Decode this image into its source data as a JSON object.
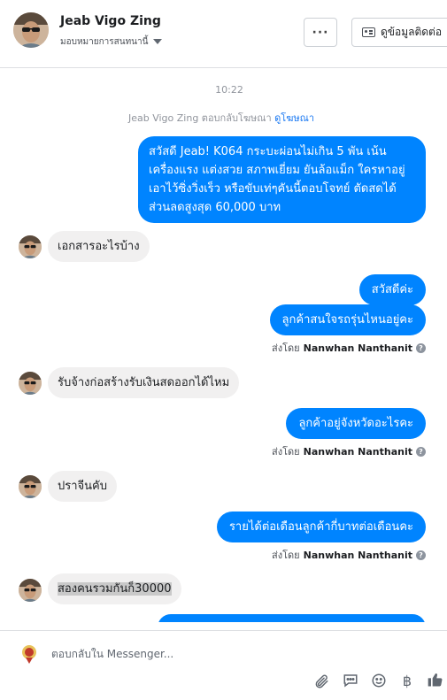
{
  "header": {
    "name": "Jeab Vigo Zing",
    "assign_label": "มอบหมายการสนทนานี้",
    "more_label": "···",
    "contact_label": "ดูข้อมูลติดต่อ"
  },
  "conversation": {
    "timestamp": "10:22",
    "reply_note": {
      "prefix": "Jeab Vigo Zing ตอบกลับโฆษณา",
      "link": "ดูโฆษณา"
    },
    "messages": [
      {
        "dir": "out",
        "text": "สวัสดี Jeab! K064 กระบะผ่อนไม่เกิน 5 พัน เน้นเครื่องแรง แต่งสวย สภาพเยี่ยม ยันล้อแม็ก ใครหาอยู่เอาไว้ซิ่งวิ่งเร็ว หรือขับเท่ๆคันนี้ตอบโจทย์ ตัดสดได้ส่วนลดสูงสุด 60,000 บาท"
      },
      {
        "dir": "in",
        "text": "เอกสารอะไรบ้าง"
      },
      {
        "dir": "out",
        "text": "สวัสดีค่ะ"
      },
      {
        "dir": "out",
        "text": "ลูกค้าสนใจรถรุ่นไหนอยู่คะ"
      },
      {
        "dir": "in",
        "text": "รับจ้างก่อสร้างรับเงินสดออกได้ไหม"
      },
      {
        "dir": "out",
        "text": "ลูกค้าอยู่จังหวัดอะไรคะ"
      },
      {
        "dir": "in",
        "text": "ปราจีนคับ"
      },
      {
        "dir": "out",
        "text": "รายได้ต่อเดือนลูกค้ากี่บาทต่อเดือนคะ"
      },
      {
        "dir": "in",
        "text": "สองคนรวมกันก็30000"
      }
    ],
    "sent_by_prefix": "ส่งโดย",
    "sent_by_name": "Nanwhan Nanthanit",
    "help_glyph": "?"
  },
  "composer": {
    "placeholder": "ตอบกลับใน Messenger..."
  },
  "icons": {
    "attach": "paperclip-icon",
    "saved_reply": "speech-bubble-icon",
    "emoji": "smiley-icon",
    "payment": "baht-icon",
    "like": "thumbs-up-icon"
  },
  "colors": {
    "outgoing_bubble": "#0084ff",
    "incoming_bubble": "#f1f0f0",
    "link": "#1877f2"
  }
}
